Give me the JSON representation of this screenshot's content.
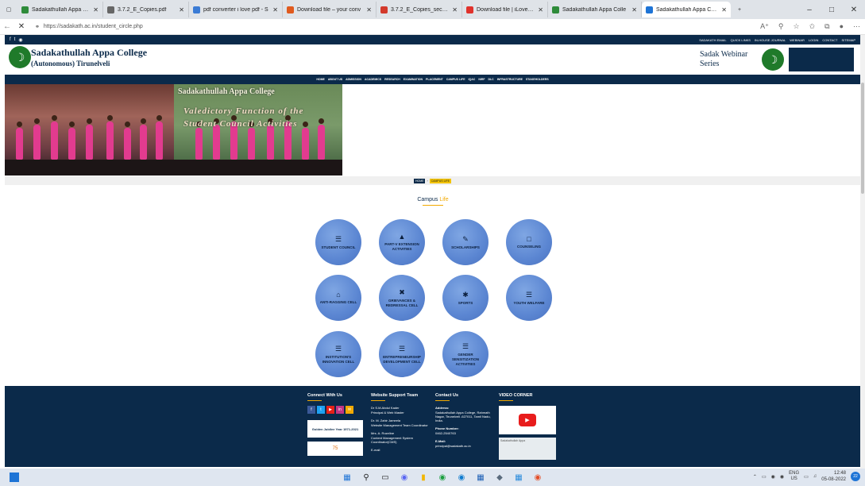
{
  "browser": {
    "tabs": [
      {
        "title": "Sadakathullah Appa Colle",
        "icon_color": "#2e8b3a",
        "active": false
      },
      {
        "title": "3.7.2_E_Copies.pdf",
        "icon_color": "#666666",
        "active": false
      },
      {
        "title": "pdf converter i love pdf - S",
        "icon_color": "#3a7bd5",
        "active": false
      },
      {
        "title": "Download file – your conv",
        "icon_color": "#e05a1e",
        "active": false
      },
      {
        "title": "3.7.2_E_Copies_second hal",
        "icon_color": "#d33a2c",
        "active": false
      },
      {
        "title": "Download file | iLovePDF",
        "icon_color": "#e0322c",
        "active": false
      },
      {
        "title": "Sadakathullah Appa Colle",
        "icon_color": "#2e8b3a",
        "active": false
      },
      {
        "title": "Sadakathullah Appa Colle",
        "icon_color": "#1e74d6",
        "active": true
      }
    ],
    "new_tab": "+",
    "url": "https://sadakath.ac.in/student_circle.php",
    "win_controls": [
      "–",
      "□",
      "✕"
    ]
  },
  "site": {
    "topstrip_links": [
      "SADAKATH EMAIL",
      "QUICK LINKS",
      "IN-HOUSE JOURNAL",
      "WEBINAR",
      "LOGIN",
      "CONTACT",
      "SITEMAP"
    ],
    "college_name": "Sadakathullah Appa College",
    "college_sub": "(Autonomous) Tirunelveli",
    "webinar_title": "Sadak Webinar Series",
    "menu": [
      "HOME",
      "ABOUT US",
      "ADMISSION",
      "ACADEMICS",
      "RESEARCH",
      "EXAMINATION",
      "PLACEMENT",
      "CAMPUS LIFE",
      "IQAC",
      "NIRF",
      "DLC",
      "INFRASTRUCTURE",
      "STAKEHOLDERS"
    ],
    "banner_title": "Sadakathullah Appa College",
    "banner_caption": "Valedictory Function of the Student Council Activities",
    "breadcrumb": [
      "HOME",
      "CAMPUS LIFE"
    ],
    "page_title_a": "Campus",
    "page_title_b": "Life"
  },
  "circles": [
    {
      "label": "STUDENT COUNCIL",
      "icon": "users-icon"
    },
    {
      "label": "PART-V EXTENSION ACTIVITIES",
      "icon": "graduation-icon"
    },
    {
      "label": "SCHOLARSHIPS",
      "icon": "pen-icon"
    },
    {
      "label": "COUNSELING",
      "icon": "document-icon"
    },
    {
      "label": "ANTI-RAGGING CELL",
      "icon": "building-icon"
    },
    {
      "label": "GRIEVANCES & REDRESSAL CELL",
      "icon": "close-icon"
    },
    {
      "label": "SPORTS",
      "icon": "runner-icon"
    },
    {
      "label": "YOUTH WELFARE",
      "icon": "users-icon"
    },
    {
      "label": "INSTITUTION'S INNOVATION CELL",
      "icon": "users-icon"
    },
    {
      "label": "ENTREPRENEURSHIP DEVELOPMENT CELL",
      "icon": "users-icon"
    },
    {
      "label": "GENDER SENSITIZATION ACTIVITIES",
      "icon": "users-icon"
    }
  ],
  "footer": {
    "connect_title": "Connect With Us",
    "social": [
      {
        "glyph": "f",
        "color": "#3b5998"
      },
      {
        "glyph": "t",
        "color": "#1da1f2"
      },
      {
        "glyph": "▶",
        "color": "#e62117"
      },
      {
        "glyph": "in",
        "color": "#c13584"
      },
      {
        "glyph": "✉",
        "color": "#f2a900"
      }
    ],
    "jubilee": "Golden Jubilee Year 1971-2021",
    "azadi": "75",
    "support_title": "Website Support Team",
    "support": [
      "Dr S.M.Abdul Kader",
      "Principal & Web Master",
      "Dr. M. Zahir Jameela",
      "Website Management Team Coordinator",
      "Mrs. A. Rozeline",
      "Content Management System Coordinator(CMS)",
      "E-mail"
    ],
    "contact_title": "Contact Us",
    "contact": [
      "Address:",
      "Sadakathullah Appa College, Rahmath Nagar, Tirunelveli -627011, Tamil Nadu, India.",
      "Phone Number:",
      "0462-2540763",
      "E-Mail:",
      "principal@sadakath.ac.in"
    ],
    "video_title": "VIDEO CORNER",
    "map_label": "Sadakathullah Appa"
  },
  "taskbar": {
    "lang": "ENG",
    "lang_sub": "US",
    "time": "12:48",
    "date": "05-08-2022",
    "notif": "22"
  }
}
